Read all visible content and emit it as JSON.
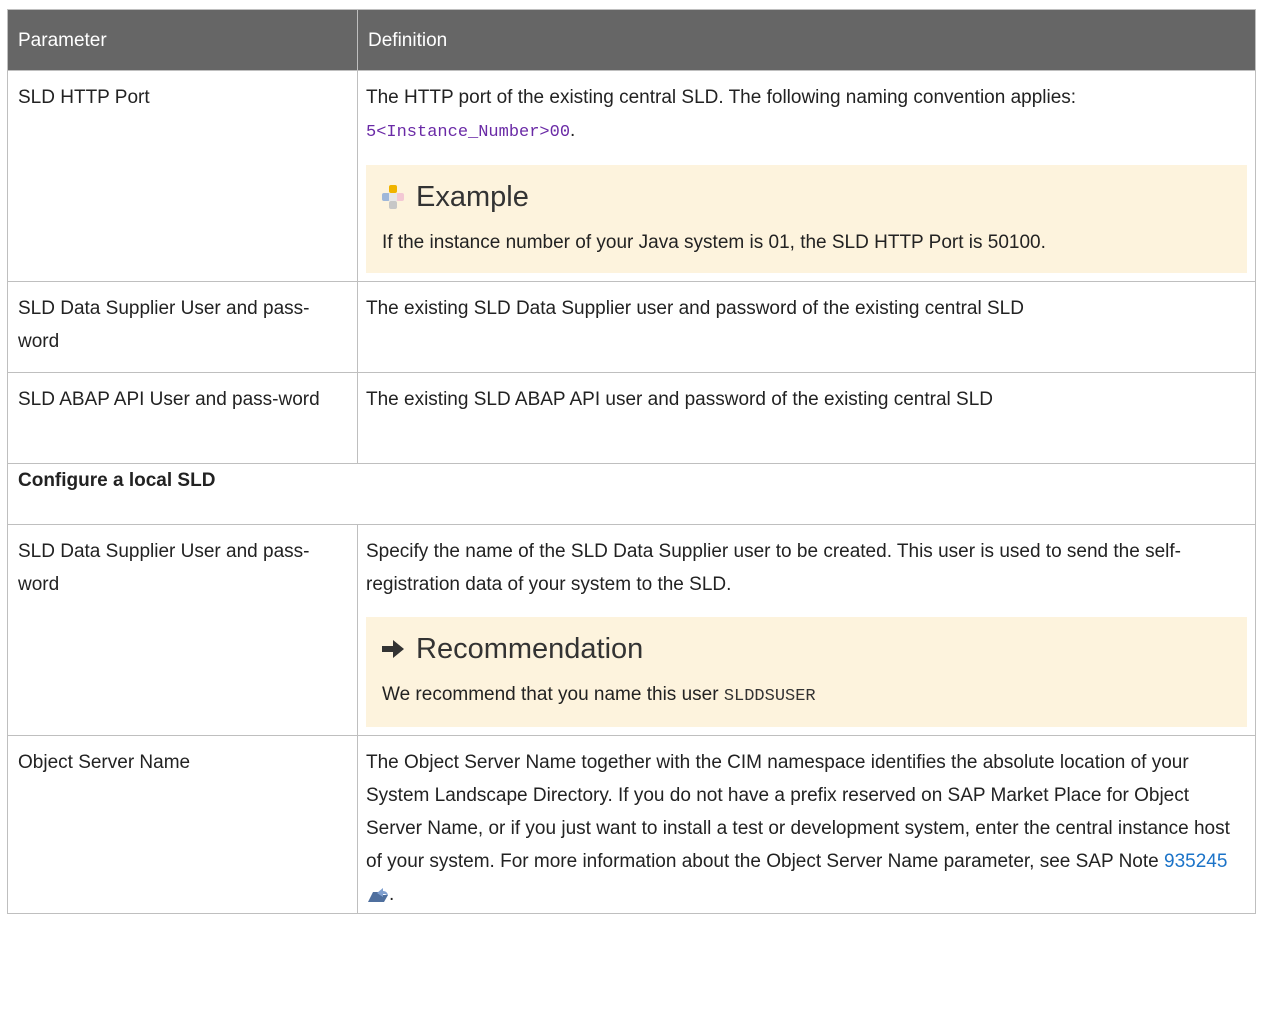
{
  "header": {
    "parameter": "Parameter",
    "definition": "Definition"
  },
  "rows": [
    {
      "parameter": "SLD HTTP Port",
      "definition": "The HTTP port of the existing central SLD. The following naming convention applies:",
      "code_prefix": "5",
      "code_var": "<Instance_Number>",
      "code_suffix": "00",
      "code_end": ".",
      "callout": {
        "title": "Example",
        "body": "If the instance number of your Java system is 01, the SLD HTTP Port is 50100."
      }
    },
    {
      "parameter": "SLD Data Supplier User and pass-word",
      "definition": "The existing SLD Data Supplier user and password of the existing central SLD"
    },
    {
      "parameter": "SLD ABAP API User and pass-word",
      "definition": "The existing SLD ABAP API user and password of the existing central SLD"
    },
    {
      "section": "Configure a local SLD"
    },
    {
      "parameter": "SLD Data Supplier User and pass-word",
      "definition": "Specify the name of the SLD Data Supplier user to be created. This user is used to send the self-registration data of your system to the SLD.",
      "callout": {
        "title": "Recommendation",
        "body": "We recommend that you name this user",
        "code": "SLDDSUSER"
      }
    },
    {
      "parameter": "Object Server Name",
      "definition": "The Object Server Name together with the CIM namespace identifies the absolute location of your System Landscape Directory. If you do not have a prefix reserved on SAP Market Place for Object Server Name, or if you just want to install a test or development system, enter the central instance host of your system. For more information about the Object Server Name parameter, see SAP Note",
      "note_link": "935245",
      "end": "."
    }
  ],
  "colors": {
    "header_bg": "#666666",
    "callout_bg": "#fdf3dd",
    "link": "#1b73c8",
    "code_var": "#6a2aa6"
  },
  "icons": {
    "example": "example-puzzle-icon",
    "recommendation": "arrow-right-icon",
    "link": "external-link-icon"
  }
}
